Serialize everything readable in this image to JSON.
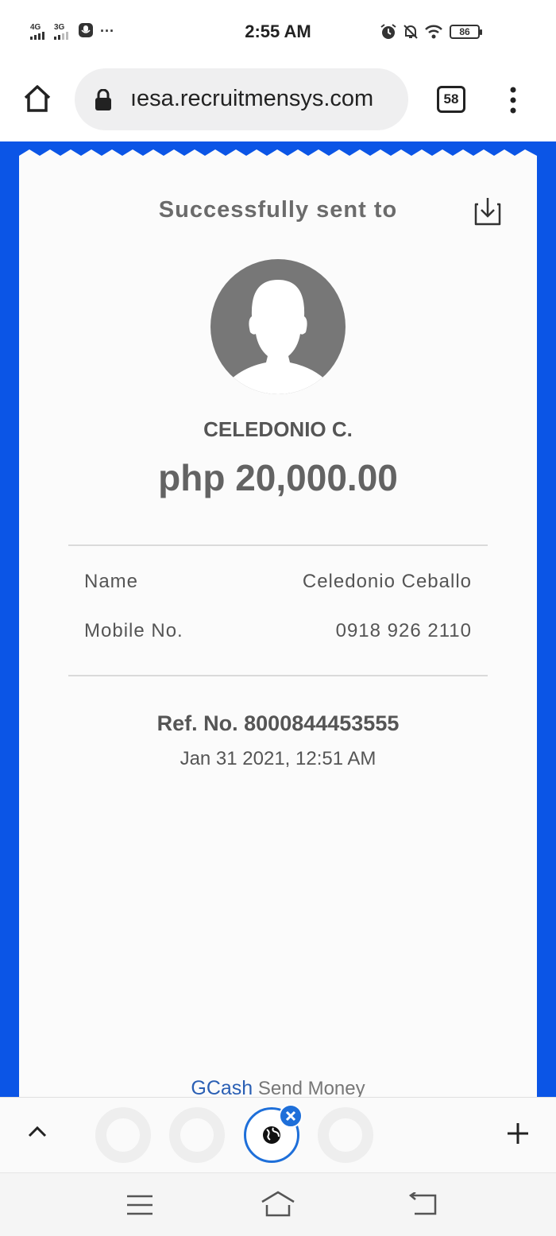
{
  "status_bar": {
    "time": "2:55 AM",
    "network_1": "4G",
    "network_2": "3G",
    "more": "···",
    "battery": "86"
  },
  "browser": {
    "url": "ıesa.recruitmensys.com",
    "tab_count": "58"
  },
  "receipt": {
    "title": "Successfully sent to",
    "recipient_short": "CELEDONIO C.",
    "amount": "php 20,000.00",
    "details": [
      {
        "label": "Name",
        "value": "Celedonio Ceballo"
      },
      {
        "label": "Mobile No.",
        "value": "0918 926 2110"
      }
    ],
    "reference": "Ref. No. 8000844453555",
    "datetime": "Jan 31 2021, 12:51 AM",
    "footer_brand": "GCash",
    "footer_text": "Send Money"
  },
  "colors": {
    "frame_blue": "#0b55e6",
    "accent_blue": "#1e6fd9"
  }
}
